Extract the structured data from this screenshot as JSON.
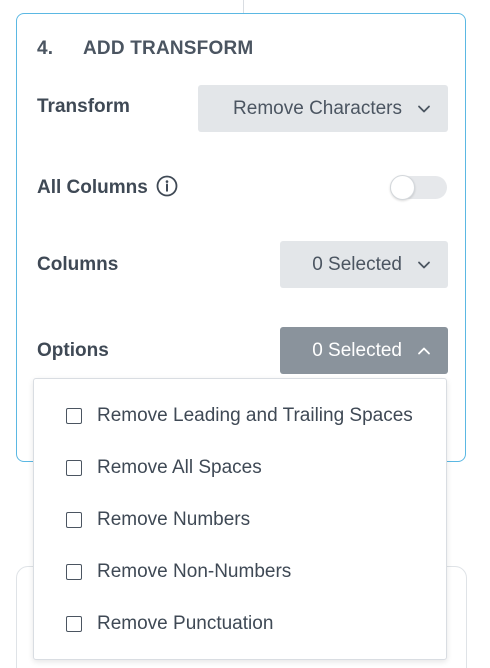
{
  "step": {
    "number": "4.",
    "title": "ADD TRANSFORM"
  },
  "transform": {
    "label": "Transform",
    "value": "Remove Characters"
  },
  "all_columns": {
    "label": "All Columns",
    "enabled": false
  },
  "columns": {
    "label": "Columns",
    "value": "0 Selected"
  },
  "options": {
    "label": "Options",
    "value": "0 Selected",
    "items": [
      {
        "label": "Remove Leading and Trailing Spaces",
        "checked": false
      },
      {
        "label": "Remove All Spaces",
        "checked": false
      },
      {
        "label": "Remove Numbers",
        "checked": false
      },
      {
        "label": "Remove Non-Numbers",
        "checked": false
      },
      {
        "label": "Remove Punctuation",
        "checked": false
      }
    ]
  },
  "colors": {
    "card_border": "#5bb8e3",
    "button_bg": "#e3e6e9",
    "active_button_bg": "#8a939c",
    "text": "#3f4955"
  }
}
